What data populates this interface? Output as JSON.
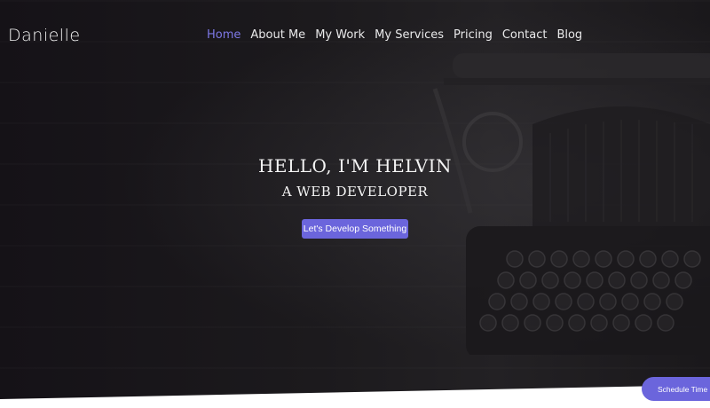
{
  "header": {
    "logo": "Danielle",
    "nav": [
      {
        "label": "Home",
        "active": true
      },
      {
        "label": "About Me",
        "active": false
      },
      {
        "label": "My Work",
        "active": false
      },
      {
        "label": "My Services",
        "active": false
      },
      {
        "label": "Pricing",
        "active": false
      },
      {
        "label": "Contact",
        "active": false
      },
      {
        "label": "Blog",
        "active": false
      }
    ]
  },
  "hero": {
    "headline": "HELLO, I'M HELVIN",
    "subheadline": "A WEB DEVELOPER",
    "cta_label": "Let's Develop Something",
    "background_image": "typewriter"
  },
  "floating": {
    "schedule_label": "Schedule Time"
  },
  "colors": {
    "accent": "#6b65dc",
    "active_nav": "#7d78e6",
    "hero_bg": "#1c1a1d",
    "text": "#f4f4f4"
  }
}
